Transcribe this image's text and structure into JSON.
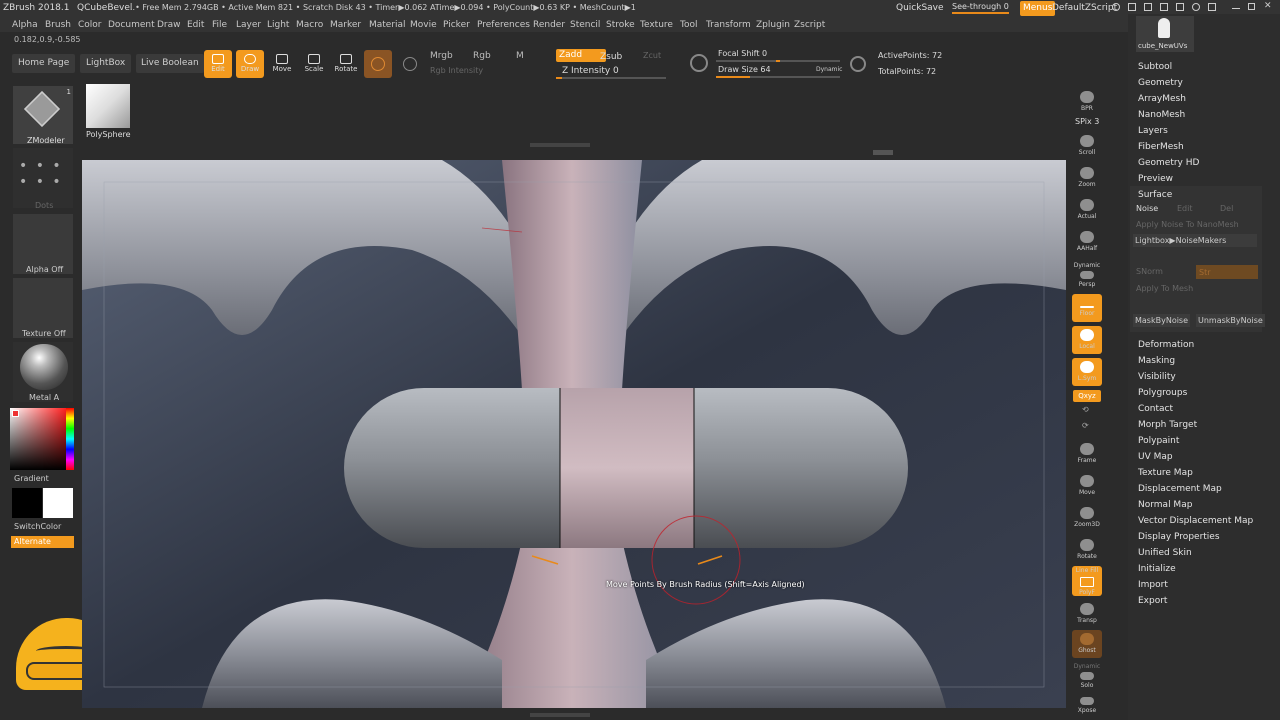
{
  "menubar": {
    "app_title": "ZBrush 2018.1",
    "document_name": "QCubeBevel",
    "stats": "..• Free Mem 2.794GB • Active Mem 821 • Scratch Disk 43 • Timer▶0.062 ATime▶0.094 • PolyCount▶0.63 KP • MeshCount▶1",
    "quicksave": "QuickSave",
    "see_through": "See-through  0",
    "menus": "Menus",
    "default_zscript": "DefaultZScript",
    "items": [
      "Alpha",
      "Brush",
      "Color",
      "Document",
      "Draw",
      "Edit",
      "File",
      "Layer",
      "Light",
      "Macro",
      "Marker",
      "Material",
      "Movie",
      "Picker",
      "Preferences",
      "Render",
      "Stencil",
      "Stroke",
      "Texture",
      "Tool",
      "Transform",
      "Zplugin",
      "Zscript"
    ]
  },
  "coords": "0.182,0.9,-0.585",
  "toolbar": {
    "home_page": "Home Page",
    "lightbox": "LightBox",
    "live_boolean": "Live Boolean",
    "edit": "Edit",
    "draw": "Draw",
    "move": "Move",
    "scale": "Scale",
    "rotate": "Rotate",
    "mrgb": "Mrgb",
    "rgb": "Rgb",
    "m": "M",
    "rgb_intensity": "Rgb Intensity",
    "zadd": "Zadd",
    "zsub": "Zsub",
    "zcut": "Zcut",
    "z_intensity": "Z Intensity 0",
    "focal_shift": "Focal Shift 0",
    "draw_size": "Draw Size 64",
    "dynamic": "Dynamic",
    "active_points": "ActivePoints: 72",
    "total_points": "TotalPoints: 72"
  },
  "left_shelf": {
    "brush_name": "ZModeler",
    "brush_badge": "1",
    "stroke_name": "Dots",
    "alpha_label": "Alpha Off",
    "texture_label": "Texture Off",
    "material_label": "Metal A",
    "gradient_label": "Gradient",
    "switch_color": "SwitchColor",
    "alternate": "Alternate"
  },
  "tool_thumb": {
    "label": "PolySphere"
  },
  "viewport": {
    "tooltip": "Move Points By Brush Radius (Shift=Axis Aligned)"
  },
  "right_shelf": {
    "bpr": "BPR",
    "spix": "SPix 3",
    "scroll": "Scroll",
    "zoom": "Zoom",
    "actual": "Actual",
    "aahalf": "AAHalf",
    "dynamic": "Dynamic",
    "persp": "Persp",
    "floor": "Floor",
    "local": "Local",
    "lsym": "L.Sym",
    "qxyz": "Qxyz",
    "frame": "Frame",
    "move": "Move",
    "zoom3d": "Zoom3D",
    "rotate": "Rotate",
    "line_fill": "Line Fill",
    "polyf": "PolyF",
    "transp": "Transp",
    "ghost": "Ghost",
    "solo": "Solo",
    "xpose": "Xpose"
  },
  "right_panel": {
    "tool_name": "cube_NewUVs",
    "subtool": "Subtool",
    "geometry": "Geometry",
    "arraymesh": "ArrayMesh",
    "nanomesh": "NanoMesh",
    "layers": "Layers",
    "fibermesh": "FiberMesh",
    "geometry_hd": "Geometry HD",
    "preview": "Preview",
    "surface": "Surface",
    "noise": "Noise",
    "edit": "Edit",
    "del": "Del",
    "apply_noise_nanomesh": "Apply Noise To NanoMesh",
    "lightbox_noisemakers": "Lightbox▶NoiseMakers",
    "snorm": "SNorm",
    "strength": "Str",
    "apply_to_mesh": "Apply To Mesh",
    "mask_by_noise": "MaskByNoise",
    "unmask_by_noise": "UnmaskByNoise",
    "sections": [
      "Deformation",
      "Masking",
      "Visibility",
      "Polygroups",
      "Contact",
      "Morph Target",
      "Polypaint",
      "UV Map",
      "Texture Map",
      "Displacement Map",
      "Normal Map",
      "Vector Displacement Map",
      "Display Properties",
      "Unified Skin",
      "Initialize",
      "Import",
      "Export"
    ]
  },
  "colors": {
    "accent": "#f39a1e",
    "panel": "#2b2b2b",
    "menubar": "#333333"
  }
}
